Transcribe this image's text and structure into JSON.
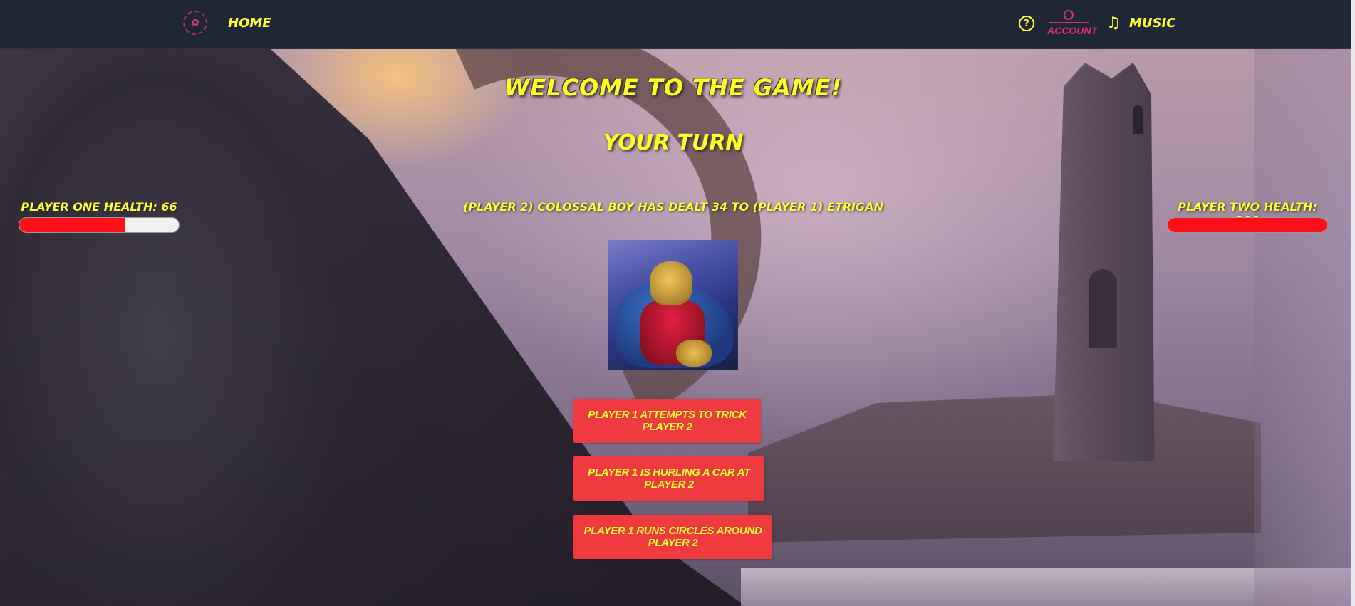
{
  "nav": {
    "home_label": "HOME",
    "account_label": "ACCOUNT",
    "music_label": "MUSIC",
    "help_glyph": "?",
    "icons": [
      "logo-icon",
      "help-icon",
      "account-icon",
      "music-icon"
    ]
  },
  "game": {
    "title": "WELCOME TO THE GAME!",
    "turn": "YOUR TURN",
    "message": "(PLAYER 2) COLOSSAL BOY HAS DEALT 34 TO (PLAYER 1) ETRIGAN",
    "player_one": {
      "label": "PLAYER ONE HEALTH: 66",
      "health": 66,
      "max": 100
    },
    "player_two": {
      "label": "PLAYER TWO HEALTH: 100",
      "health": 100,
      "max": 100
    },
    "actions": [
      {
        "label": "PLAYER 1 ATTEMPTS TO TRICK PLAYER 2"
      },
      {
        "label": "PLAYER 1 IS HURLING A CAR AT PLAYER 2"
      },
      {
        "label": "PLAYER 1 RUNS CIRCLES AROUND PLAYER 2"
      }
    ]
  },
  "colors": {
    "accent_yellow": "#ffff33",
    "health_red": "#ff0f1a",
    "button_red": "#ef3b3f",
    "account_pink": "#d2357a",
    "nav_bg": "#1f2636"
  }
}
